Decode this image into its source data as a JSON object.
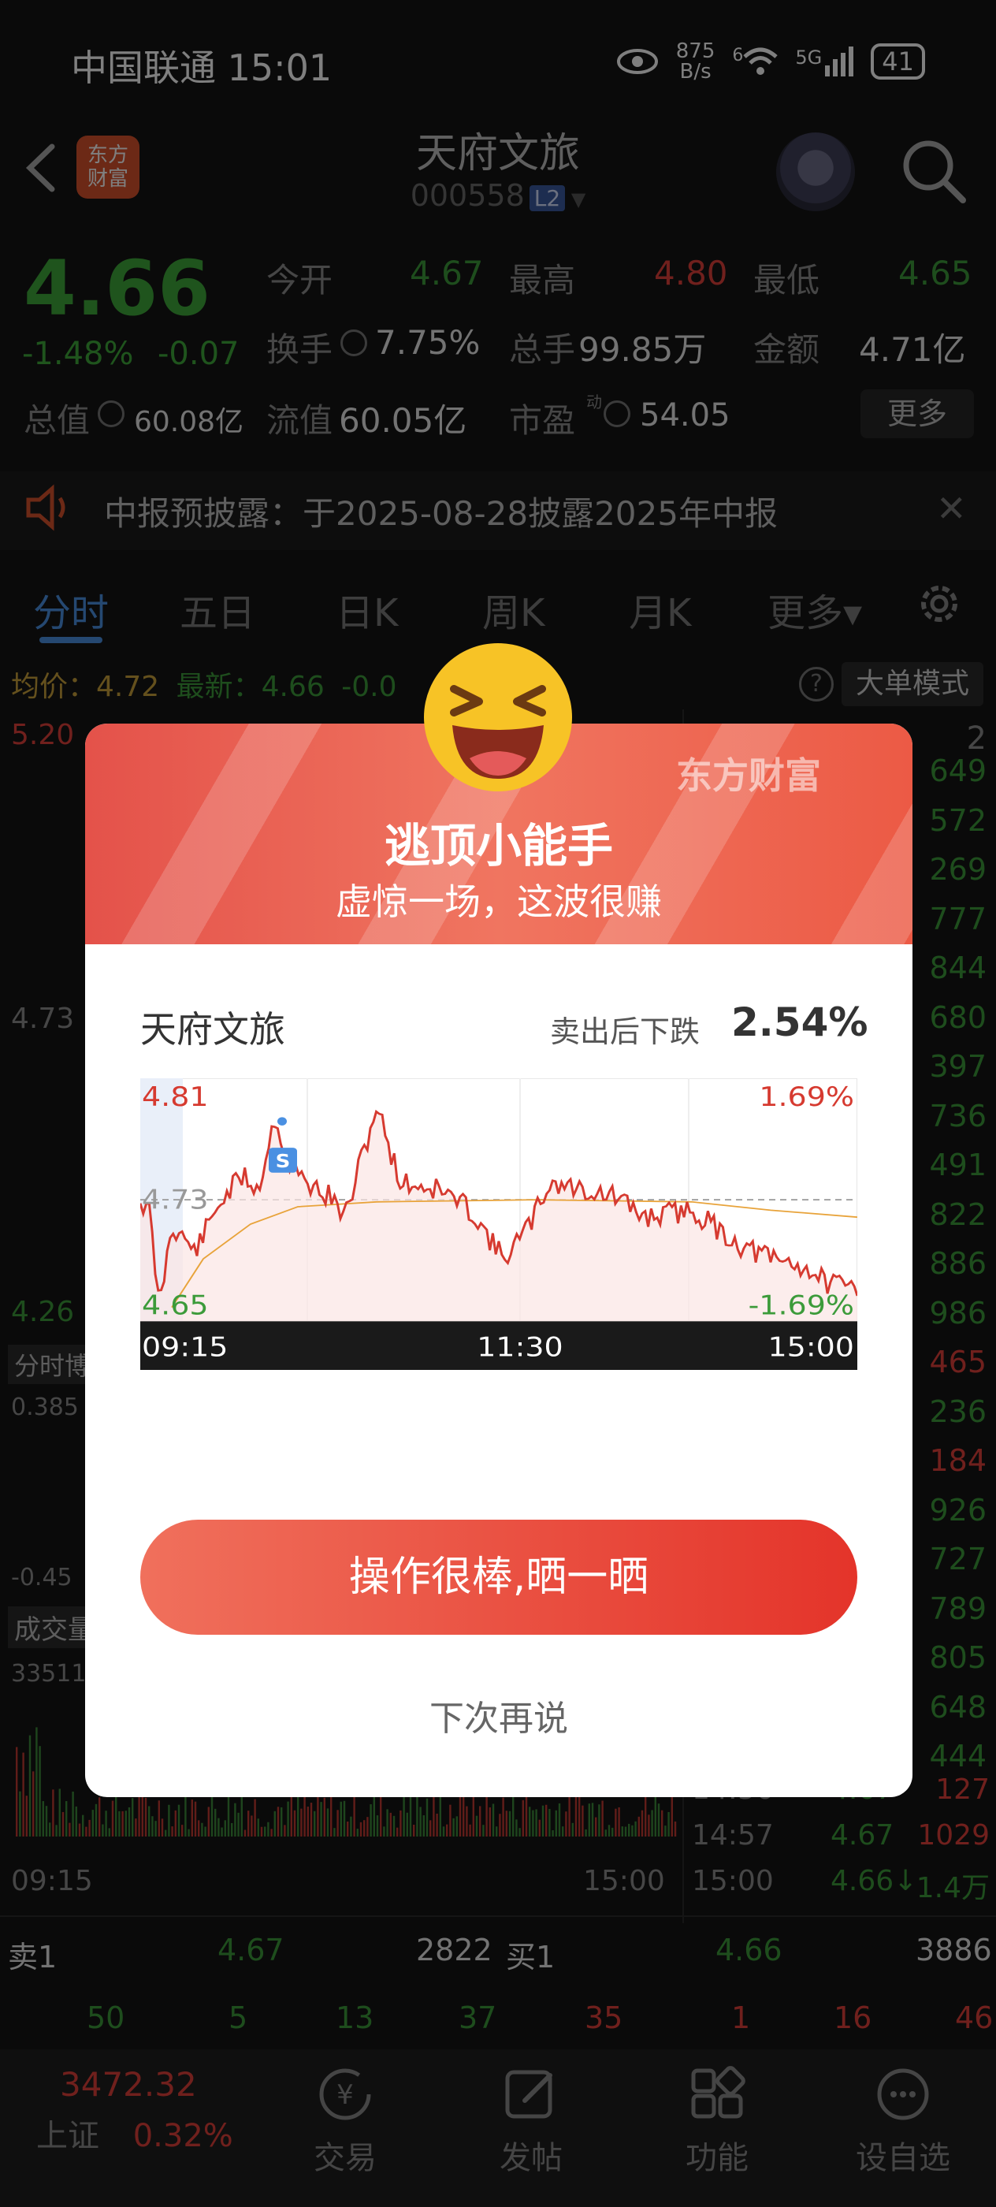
{
  "status": {
    "carrier_time": "中国联通 15:01",
    "speed_top": "875",
    "speed_bottom": "B/s",
    "wifi_tag": "6",
    "net": "5G",
    "battery": "41"
  },
  "header": {
    "logo_line1": "东方",
    "logo_line2": "财富",
    "stock_name": "天府文旅",
    "stock_code": "000558",
    "level_badge": "L2"
  },
  "quote": {
    "price": "4.66",
    "change_pct": "-1.48%",
    "change_abs": "-0.07",
    "open_label": "今开",
    "open": "4.67",
    "high_label": "最高",
    "high": "4.80",
    "low_label": "最低",
    "low": "4.65",
    "turnover_label": "换手",
    "turnover": "7.75%",
    "volume_label": "总手",
    "volume": "99.85万",
    "amount_label": "金额",
    "amount": "4.71亿",
    "mktcap_label": "总值",
    "mktcap": "60.08亿",
    "float_label": "流值",
    "float": "60.05亿",
    "pe_label": "市盈",
    "pe_sup": "动",
    "pe": "54.05",
    "more": "更多"
  },
  "notice": {
    "text": "中报预披露：于2025-08-28披露2025年中报"
  },
  "tabs": [
    "分时",
    "五日",
    "日K",
    "周K",
    "月K",
    "更多▾"
  ],
  "chart_info": {
    "avg": "均价：4.72",
    "latest": "最新：4.66",
    "chg": "-0.0",
    "big_order_mode": "大单模式"
  },
  "bg_chart": {
    "y_top": "5.20",
    "y_mid": "4.73",
    "y_low": "4.26",
    "game_label": "分时博",
    "game_top": "0.385",
    "game_bottom": "-0.45",
    "vol_label": "成交量",
    "vol_top": "33511",
    "t_start": "09:15",
    "t_end": "15:00"
  },
  "right_list": {
    "top_label": "2",
    "values": [
      "649",
      "572",
      "269",
      "777",
      "844",
      "680",
      "397",
      "736",
      "491",
      "822",
      "886",
      "986",
      "465",
      "236",
      "184",
      "926",
      "727",
      "789",
      "805",
      "648",
      "444"
    ],
    "ticks": [
      {
        "time": "14:56",
        "price": "4.67",
        "vol": "127"
      },
      {
        "time": "14:57",
        "price": "4.67",
        "vol": "1029"
      },
      {
        "time": "15:00",
        "price": "4.66↓",
        "vol": "1.4万"
      }
    ]
  },
  "orderbook": {
    "sell_label": "卖1",
    "sell_price": "4.67",
    "sell_vol": "2822",
    "buy_label": "买1",
    "buy_price": "4.66",
    "buy_vol": "3886",
    "sell_row": [
      "50",
      "5",
      "13",
      "37"
    ],
    "buy_row": [
      "35",
      "1",
      "16",
      "46"
    ]
  },
  "bottom_nav": {
    "index_value": "3472.32",
    "index_name": "上证",
    "index_pct": "0.32%",
    "items": [
      "交易",
      "发帖",
      "功能",
      "设自选"
    ]
  },
  "modal": {
    "brand": "东方财富",
    "title": "逃顶小能手",
    "subtitle": "虚惊一场，这波很赚",
    "stock_name": "天府文旅",
    "drop_label": "卖出后下跌",
    "drop_value": "2.54%",
    "mini_high": "4.81",
    "mini_mid": "4.73",
    "mini_low": "4.65",
    "mini_high_pct": "1.69%",
    "mini_low_pct": "-1.69%",
    "sell_marker": "S",
    "t_start": "09:15",
    "t_mid": "11:30",
    "t_end": "15:00",
    "share_button": "操作很棒,晒一晒",
    "later": "下次再说"
  },
  "colors": {
    "up": "#e0413a",
    "down": "#3c9b3a",
    "accent": "#4a90e2",
    "modal_red": "#e4342a"
  }
}
